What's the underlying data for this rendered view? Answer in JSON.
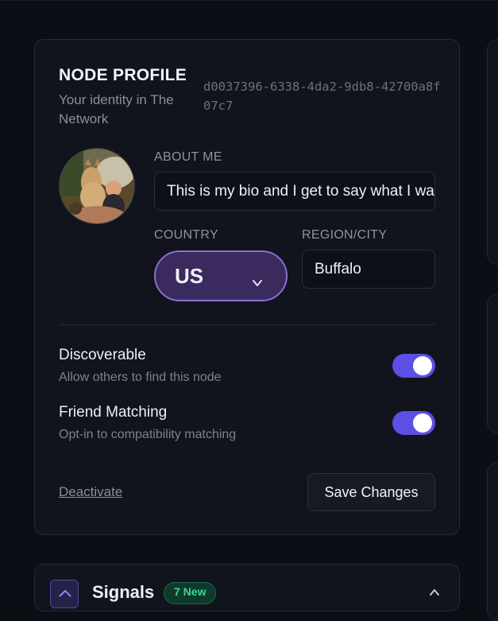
{
  "profile": {
    "title": "NODE PROFILE",
    "subtitle": "Your identity in The Network",
    "node_id": "d0037396-6338-4da2-9db8-42700a8f07c7",
    "about_label": "ABOUT ME",
    "about_value": "This is my bio and I get to say what I want",
    "country_label": "COUNTRY",
    "country_value": "US",
    "region_label": "REGION/CITY",
    "region_value": "Buffalo",
    "toggles": [
      {
        "title": "Discoverable",
        "description": "Allow others to find this node",
        "on": true
      },
      {
        "title": "Friend Matching",
        "description": "Opt-in to compatibility matching",
        "on": true
      }
    ],
    "deactivate_label": "Deactivate",
    "save_label": "Save Changes"
  },
  "signals": {
    "title": "Signals",
    "badge": "7 New"
  },
  "icons": {
    "country_select": "chevron-down-icon",
    "signals": "signal-icon",
    "signals_collapse": "chevron-up-icon"
  },
  "colors": {
    "accent": "#5b4fe6",
    "select_bg": "#3a2a5e",
    "select_border": "#8b6fd0",
    "badge_text": "#3fd39a"
  }
}
